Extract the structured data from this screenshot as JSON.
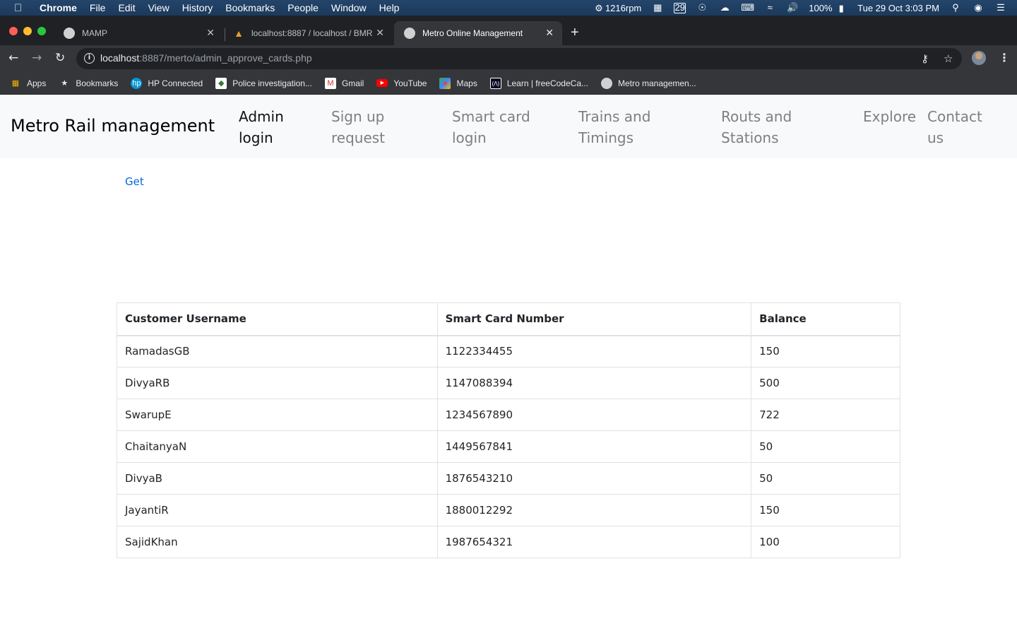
{
  "menubar": {
    "items": [
      "Chrome",
      "File",
      "Edit",
      "View",
      "History",
      "Bookmarks",
      "People",
      "Window",
      "Help"
    ],
    "fan": "1216rpm",
    "calendar_day": "29",
    "battery": "100%",
    "datetime": "Tue 29 Oct  3:03 PM"
  },
  "tabs": [
    {
      "title": "MAMP"
    },
    {
      "title": "localhost:8887 / localhost / BMR"
    },
    {
      "title": "Metro Online Management"
    }
  ],
  "address": {
    "host": "localhost",
    "path": ":8887/merto/admin_approve_cards.php"
  },
  "bookmarks": [
    "Apps",
    "Bookmarks",
    "HP Connected",
    "Police investigation...",
    "Gmail",
    "YouTube",
    "Maps",
    "Learn | freeCodeCa...",
    "Metro managemen..."
  ],
  "navbar": {
    "brand": "Metro Rail management",
    "links": [
      {
        "line1": "Admin",
        "line2": "login"
      },
      {
        "line1": "Sign up",
        "line2": "request"
      },
      {
        "line1": "Smart card",
        "line2": "login"
      },
      {
        "line1": "Trains and",
        "line2": "Timings"
      },
      {
        "line1": "Routs and",
        "line2": "Stations"
      },
      {
        "line1": "Explore",
        "line2": ""
      },
      {
        "line1": "Contact",
        "line2": "us"
      }
    ]
  },
  "get_link": "Get",
  "table": {
    "headers": [
      "Customer Username",
      "Smart Card Number",
      "Balance"
    ],
    "rows": [
      [
        "RamadasGB",
        "1122334455",
        "150"
      ],
      [
        "DivyaRB",
        "1147088394",
        "500"
      ],
      [
        "SwarupE",
        "1234567890",
        "722"
      ],
      [
        "ChaitanyaN",
        "1449567841",
        "50"
      ],
      [
        "DivyaB",
        "1876543210",
        "50"
      ],
      [
        "JayantiR",
        "1880012292",
        "150"
      ],
      [
        "SajidKhan",
        "1987654321",
        "100"
      ]
    ]
  }
}
